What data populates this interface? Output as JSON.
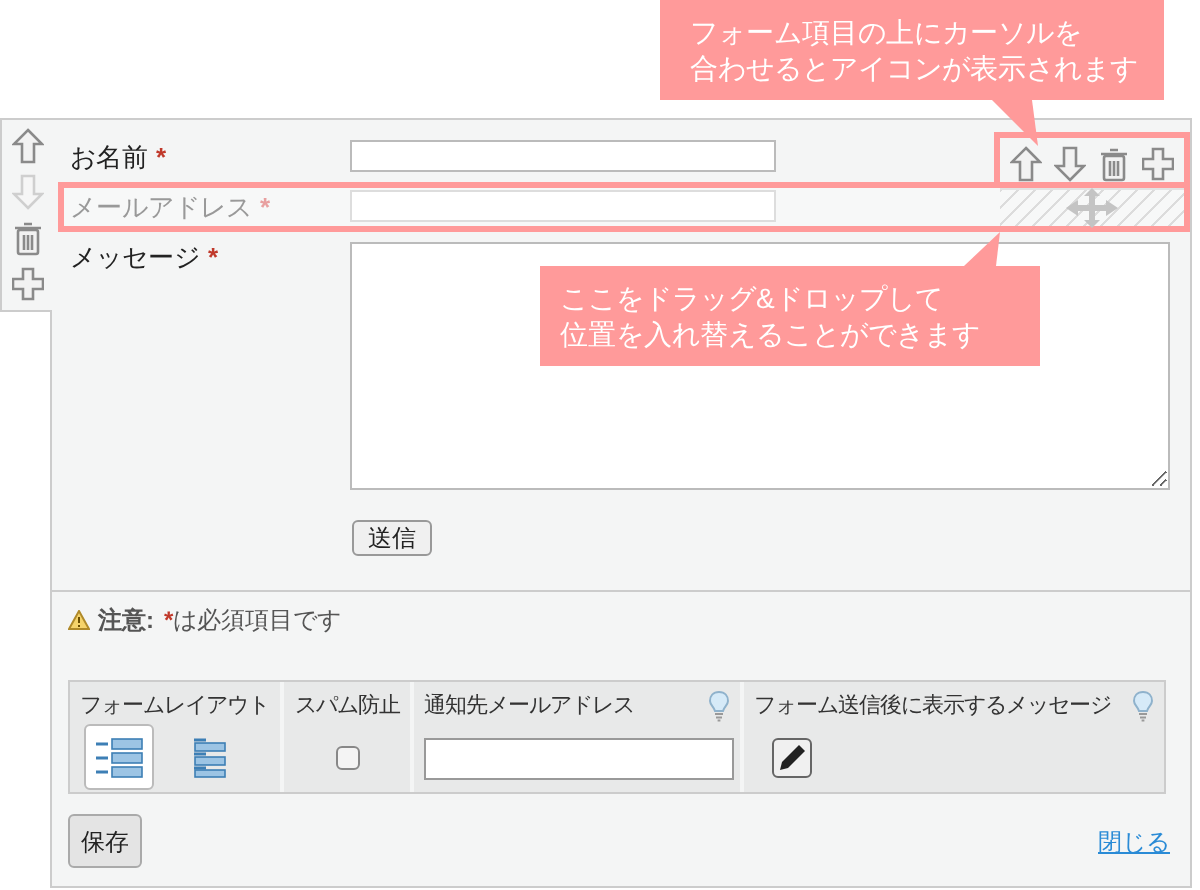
{
  "callouts": [
    {
      "lines": [
        "フォーム項目の上にカーソルを",
        "合わせるとアイコンが表示されます"
      ]
    },
    {
      "lines": [
        "ここをドラッグ&ドロップして",
        "位置を入れ替えることができます"
      ]
    }
  ],
  "left_toolbar": [
    {
      "kind": "up",
      "disabled": false
    },
    {
      "kind": "down",
      "disabled": true
    },
    {
      "kind": "delete",
      "disabled": false
    },
    {
      "kind": "add",
      "disabled": false
    }
  ],
  "row_toolbar": [
    {
      "kind": "up",
      "disabled": false
    },
    {
      "kind": "down",
      "disabled": false
    },
    {
      "kind": "delete",
      "disabled": false
    },
    {
      "kind": "add",
      "disabled": false
    }
  ],
  "fields": [
    {
      "label": "お名前",
      "required_mark": "*",
      "kind": "text",
      "highlighted": false
    },
    {
      "label": "メールアドレス",
      "required_mark": "*",
      "kind": "text",
      "highlighted": true
    },
    {
      "label": "メッセージ",
      "required_mark": "*",
      "kind": "textarea",
      "highlighted": false
    }
  ],
  "submit_button": "送信",
  "note": {
    "label": "注意:",
    "mark": "*",
    "text": "は必須項目です"
  },
  "settings": [
    {
      "kind": "layout",
      "header": "フォームレイアウト",
      "options": [
        {
          "kind": "side",
          "selected": true
        },
        {
          "kind": "stacked",
          "selected": false
        }
      ]
    },
    {
      "kind": "checkbox",
      "header": "スパム防止",
      "checked": false
    },
    {
      "kind": "email",
      "header": "通知先メールアドレス",
      "hint": true
    },
    {
      "kind": "edit",
      "header": "フォーム送信後に表示するメッセージ",
      "hint": true
    }
  ],
  "save_button": "保存",
  "close_link": "閉じる"
}
